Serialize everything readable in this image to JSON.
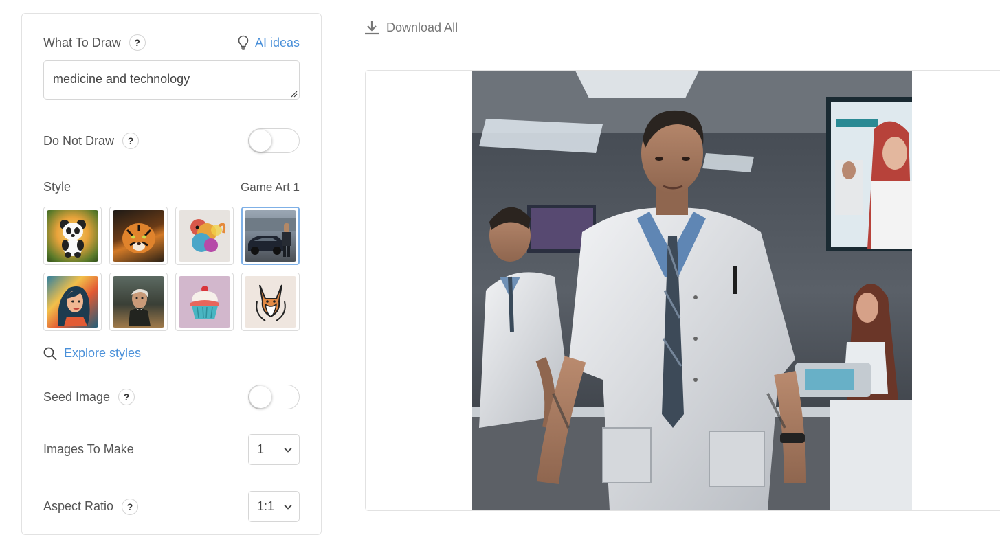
{
  "what_to_draw": {
    "label": "What To Draw",
    "help": "?",
    "ai_ideas_label": "AI ideas",
    "prompt_value": "medicine and technology"
  },
  "do_not_draw": {
    "label": "Do Not Draw",
    "help": "?",
    "enabled": false
  },
  "style": {
    "label": "Style",
    "selected_value": "Game Art 1",
    "tiles": [
      {
        "name": "panda-style",
        "icon": "panda",
        "selected": false
      },
      {
        "name": "tiger-style",
        "icon": "tiger",
        "selected": false
      },
      {
        "name": "colorful-creature-style",
        "icon": "splash-creature",
        "selected": false
      },
      {
        "name": "game-art-style",
        "icon": "game-art",
        "selected": true
      },
      {
        "name": "pop-portrait-style",
        "icon": "woman-portrait",
        "selected": false
      },
      {
        "name": "oil-painting-style",
        "icon": "old-man",
        "selected": false
      },
      {
        "name": "cupcake-style",
        "icon": "cupcake",
        "selected": false
      },
      {
        "name": "line-art-fox-style",
        "icon": "fox",
        "selected": false
      }
    ],
    "explore_label": "Explore styles"
  },
  "seed_image": {
    "label": "Seed Image",
    "help": "?",
    "enabled": false
  },
  "images_to_make": {
    "label": "Images To Make",
    "value": "1"
  },
  "aspect_ratio": {
    "label": "Aspect Ratio",
    "help": "?",
    "value": "1:1"
  },
  "toolbar": {
    "download_all_label": "Download All"
  },
  "colors": {
    "accent": "#4a90d9",
    "border": "#e2e2e2",
    "selected_tile": "#7fb0e6"
  }
}
